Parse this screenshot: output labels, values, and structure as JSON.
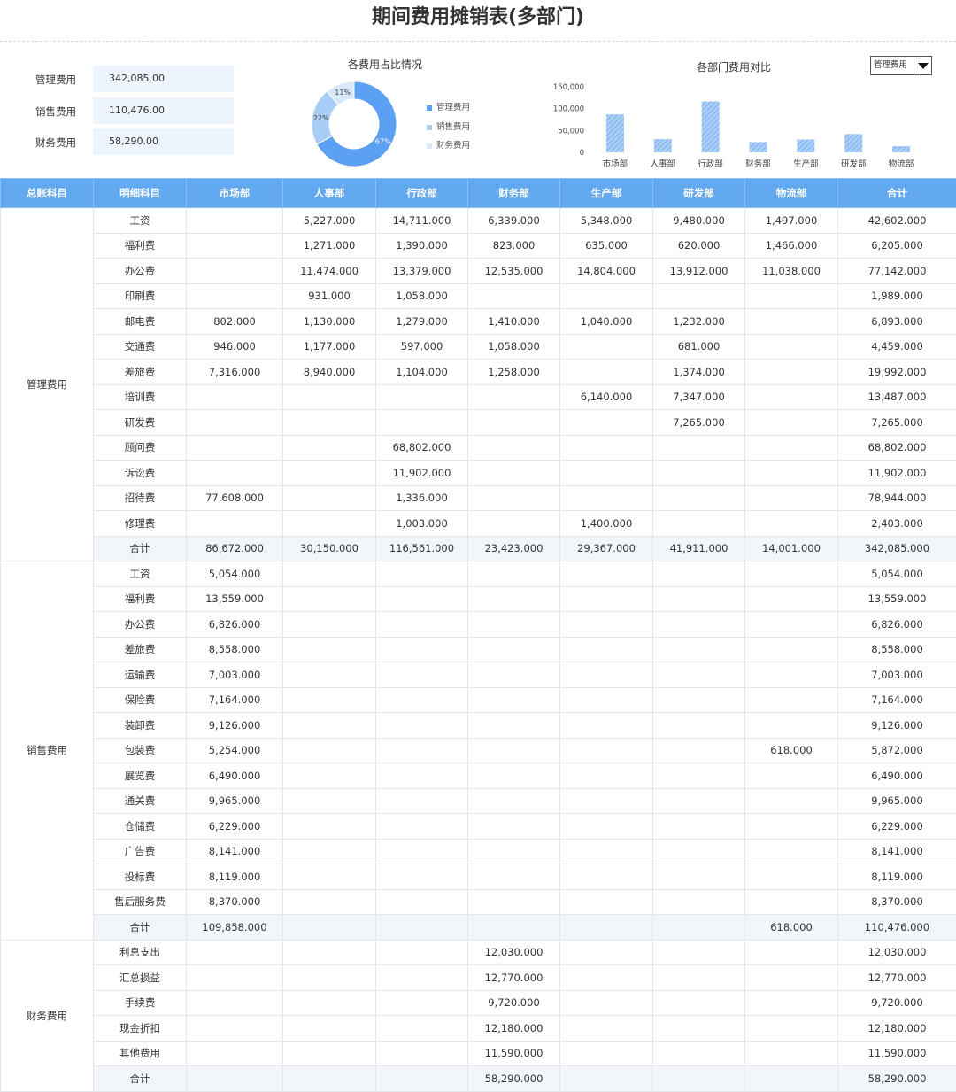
{
  "title": "期间费用摊销表(多部门)",
  "kpis": [
    {
      "label": "管理费用",
      "value": "342,085.00"
    },
    {
      "label": "销售费用",
      "value": "110,476.00"
    },
    {
      "label": "财务费用",
      "value": "58,290.00"
    }
  ],
  "pie_chart": {
    "type": "pie",
    "title": "各费用占比情况",
    "slices": [
      {
        "name": "管理费用",
        "pct_label": "67%",
        "value": 67,
        "color": "#5ba0f2"
      },
      {
        "name": "销售费用",
        "pct_label": "22%",
        "value": 22,
        "color": "#a8cdf7"
      },
      {
        "name": "财务费用",
        "pct_label": "11%",
        "value": 11,
        "color": "#d8e8fb"
      }
    ]
  },
  "chart_data": {
    "type": "bar",
    "title": "各部门费用对比",
    "categories": [
      "市场部",
      "人事部",
      "行政部",
      "财务部",
      "生产部",
      "研发部",
      "物流部"
    ],
    "values": [
      86672,
      30150,
      116561,
      23423,
      29367,
      41911,
      14001
    ],
    "y_ticks": [
      "0",
      "50,000",
      "100,000",
      "150,000"
    ],
    "ylim": [
      0,
      150000
    ],
    "bar_color": "#8fbff3"
  },
  "selector": {
    "value": "管理费用"
  },
  "table": {
    "headers": [
      "总账科目",
      "明细科目",
      "市场部",
      "人事部",
      "行政部",
      "财务部",
      "生产部",
      "研发部",
      "物流部",
      "合计"
    ],
    "groups": [
      {
        "name": "管理费用",
        "rows": [
          [
            "工资",
            "",
            "5,227.000",
            "14,711.000",
            "6,339.000",
            "5,348.000",
            "9,480.000",
            "1,497.000",
            "42,602.000"
          ],
          [
            "福利费",
            "",
            "1,271.000",
            "1,390.000",
            "823.000",
            "635.000",
            "620.000",
            "1,466.000",
            "6,205.000"
          ],
          [
            "办公费",
            "",
            "11,474.000",
            "13,379.000",
            "12,535.000",
            "14,804.000",
            "13,912.000",
            "11,038.000",
            "77,142.000"
          ],
          [
            "印刷费",
            "",
            "931.000",
            "1,058.000",
            "",
            "",
            "",
            "",
            "1,989.000"
          ],
          [
            "邮电费",
            "802.000",
            "1,130.000",
            "1,279.000",
            "1,410.000",
            "1,040.000",
            "1,232.000",
            "",
            "6,893.000"
          ],
          [
            "交通费",
            "946.000",
            "1,177.000",
            "597.000",
            "1,058.000",
            "",
            "681.000",
            "",
            "4,459.000"
          ],
          [
            "差旅费",
            "7,316.000",
            "8,940.000",
            "1,104.000",
            "1,258.000",
            "",
            "1,374.000",
            "",
            "19,992.000"
          ],
          [
            "培训费",
            "",
            "",
            "",
            "",
            "6,140.000",
            "7,347.000",
            "",
            "13,487.000"
          ],
          [
            "研发费",
            "",
            "",
            "",
            "",
            "",
            "7,265.000",
            "",
            "7,265.000"
          ],
          [
            "顾问费",
            "",
            "",
            "68,802.000",
            "",
            "",
            "",
            "",
            "68,802.000"
          ],
          [
            "诉讼费",
            "",
            "",
            "11,902.000",
            "",
            "",
            "",
            "",
            "11,902.000"
          ],
          [
            "招待费",
            "77,608.000",
            "",
            "1,336.000",
            "",
            "",
            "",
            "",
            "78,944.000"
          ],
          [
            "修理费",
            "",
            "",
            "1,003.000",
            "",
            "1,400.000",
            "",
            "",
            "2,403.000"
          ]
        ],
        "total": [
          "合计",
          "86,672.000",
          "30,150.000",
          "116,561.000",
          "23,423.000",
          "29,367.000",
          "41,911.000",
          "14,001.000",
          "342,085.000"
        ]
      },
      {
        "name": "销售费用",
        "rows": [
          [
            "工资",
            "5,054.000",
            "",
            "",
            "",
            "",
            "",
            "",
            "5,054.000"
          ],
          [
            "福利费",
            "13,559.000",
            "",
            "",
            "",
            "",
            "",
            "",
            "13,559.000"
          ],
          [
            "办公费",
            "6,826.000",
            "",
            "",
            "",
            "",
            "",
            "",
            "6,826.000"
          ],
          [
            "差旅费",
            "8,558.000",
            "",
            "",
            "",
            "",
            "",
            "",
            "8,558.000"
          ],
          [
            "运输费",
            "7,003.000",
            "",
            "",
            "",
            "",
            "",
            "",
            "7,003.000"
          ],
          [
            "保险费",
            "7,164.000",
            "",
            "",
            "",
            "",
            "",
            "",
            "7,164.000"
          ],
          [
            "装卸费",
            "9,126.000",
            "",
            "",
            "",
            "",
            "",
            "",
            "9,126.000"
          ],
          [
            "包装费",
            "5,254.000",
            "",
            "",
            "",
            "",
            "",
            "618.000",
            "5,872.000"
          ],
          [
            "展览费",
            "6,490.000",
            "",
            "",
            "",
            "",
            "",
            "",
            "6,490.000"
          ],
          [
            "通关费",
            "9,965.000",
            "",
            "",
            "",
            "",
            "",
            "",
            "9,965.000"
          ],
          [
            "仓储费",
            "6,229.000",
            "",
            "",
            "",
            "",
            "",
            "",
            "6,229.000"
          ],
          [
            "广告费",
            "8,141.000",
            "",
            "",
            "",
            "",
            "",
            "",
            "8,141.000"
          ],
          [
            "投标费",
            "8,119.000",
            "",
            "",
            "",
            "",
            "",
            "",
            "8,119.000"
          ],
          [
            "售后服务费",
            "8,370.000",
            "",
            "",
            "",
            "",
            "",
            "",
            "8,370.000"
          ]
        ],
        "total": [
          "合计",
          "109,858.000",
          "",
          "",
          "",
          "",
          "",
          "618.000",
          "110,476.000"
        ]
      },
      {
        "name": "财务费用",
        "rows": [
          [
            "利息支出",
            "",
            "",
            "",
            "12,030.000",
            "",
            "",
            "",
            "12,030.000"
          ],
          [
            "汇总损益",
            "",
            "",
            "",
            "12,770.000",
            "",
            "",
            "",
            "12,770.000"
          ],
          [
            "手续费",
            "",
            "",
            "",
            "9,720.000",
            "",
            "",
            "",
            "9,720.000"
          ],
          [
            "现金折扣",
            "",
            "",
            "",
            "12,180.000",
            "",
            "",
            "",
            "12,180.000"
          ],
          [
            "其他费用",
            "",
            "",
            "",
            "11,590.000",
            "",
            "",
            "",
            "11,590.000"
          ]
        ],
        "total": [
          "合计",
          "",
          "",
          "",
          "58,290.000",
          "",
          "",
          "",
          "58,290.000"
        ]
      }
    ]
  }
}
